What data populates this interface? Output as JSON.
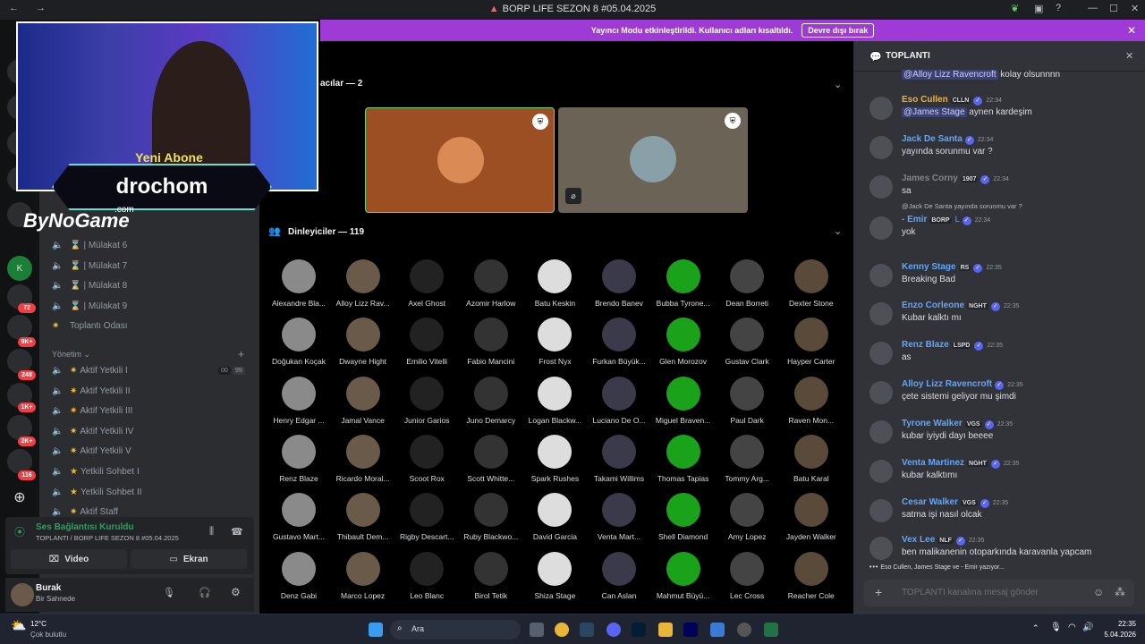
{
  "window": {
    "title": "BORP LIFE SEZON 8 #05.04.2025",
    "nav": "← →",
    "minimize": "—",
    "maximize": "☐",
    "close": "✕"
  },
  "banner": {
    "text": "Yayıncı Modu etkinleştirildi. Kullanıcı adları kısaltıldı.",
    "button": "Devre dışı bırak"
  },
  "guild_badges": [
    "72",
    "9K+",
    "248",
    "1K+",
    "2K+",
    "116"
  ],
  "channels": {
    "items": [
      {
        "name": "| Mülakat 6"
      },
      {
        "name": "| Mülakat 7"
      },
      {
        "name": "| Mülakat 8"
      },
      {
        "name": "| Mülakat 9"
      }
    ],
    "meeting_room": "Toplantı Odası",
    "category": "Yönetim",
    "admin_items": [
      {
        "name": "Aktif Yetkili I",
        "c1": "00",
        "c2": "99"
      },
      {
        "name": "Aktif Yetkili II"
      },
      {
        "name": "Aktif Yetkili III"
      },
      {
        "name": "Aktif Yetkili IV"
      },
      {
        "name": "Aktif Yetkili V"
      },
      {
        "name": "Yetkili Sohbet I"
      },
      {
        "name": "Yetkili Sohbet II"
      },
      {
        "name": "Aktif Staff"
      }
    ]
  },
  "voice": {
    "status": "Ses Bağlantısı Kuruldu",
    "channel": "TOPLANTI / BORP LIFE SEZON 8 #05.04.2025",
    "video": "Video",
    "screen": "Ekran"
  },
  "user": {
    "name": "Burak",
    "status": "Bir Sahnede"
  },
  "stream": {
    "label": "Yeni Abone",
    "name": "drochom",
    "watermark": "ByNoGame",
    "watermark_sub": ".com"
  },
  "stage": {
    "speakers_title": "acılar — 2",
    "listeners_title": "Dinleyiciler — 119",
    "listeners": [
      "Alexandre Bla...",
      "Alloy Lizz Rav...",
      "Axel Ghost",
      "Azomir Harlow",
      "Batu Keskin",
      "Brendo Banev",
      "Bubba Tyrone...",
      "Dean Borreti",
      "Dexter Stone",
      "Doğukan Koçak",
      "Dwayne Hight",
      "Emilio Vitelli",
      "Fabio Mancini",
      "Frost Nyx",
      "Furkan Büyük...",
      "Glen Morozov",
      "Gustav Clark",
      "Hayper Carter",
      "Henry Edgar ...",
      "Jamal Vance",
      "Junior Garios",
      "Juno Demarcy",
      "Logan Blackw...",
      "Luciano De O...",
      "Miguel Braven...",
      "Paul Dark",
      "Raven Mon...",
      "Renz Blaze",
      "Ricardo Moral...",
      "Scoot Rox",
      "Scott Whitte...",
      "Spark Rushes",
      "Takami Willims",
      "Thomas Tapias",
      "Tommy Arg...",
      "Batu Karal",
      "Gustavo Mart...",
      "Thibault Dem...",
      "Rigby Descart...",
      "Ruby Blackwo...",
      "David Garcia",
      "Venta Mart...",
      "Shell Diamond",
      "Amy Lopez",
      "Jayden Walker",
      "Denz Gabi",
      "Marco Lopez",
      "Leo Blanc",
      "Birol Tetik",
      "Shiza Stage",
      "Can Aslan",
      "Mahmut Büyü...",
      "Lec Cross",
      "Reacher Cole"
    ]
  },
  "chat": {
    "title": "TOPLANTI",
    "placeholder": "TOPLANTI kanalına mesaj gönder",
    "typing": "Eso Cullen, James Stage ve - Emir yazıyor...",
    "first_line": "@Alloy Lizz Ravencroft",
    "first_rest": " kolay olsunnnn",
    "messages": [
      {
        "user": "Eso Cullen",
        "color": "#f0b232",
        "tag": "CLLN",
        "time": "22:34",
        "mention": "@James Stage",
        "text": " aynen kardeşim"
      },
      {
        "user": "Jack De Santa",
        "color": "#5ea7ff",
        "tag": "",
        "time": "22:34",
        "mention": "",
        "text": "yayında sorunmu var ?"
      },
      {
        "user": "James Corny",
        "color": "#80848e",
        "tag": "1907",
        "time": "22:34",
        "mention": "",
        "text": "sa"
      },
      {
        "user": "- Emir",
        "color": "#5ea7ff",
        "tag": "BORP",
        "time": "22:34",
        "mention": "",
        "text": "yok",
        "reply": "@Jack De Santa yayında sorunmu var ?",
        "mark": "L"
      },
      {
        "user": "Kenny Stage",
        "color": "#5ea7ff",
        "tag": "RS",
        "time": "22:35",
        "mention": "",
        "text": "Breaking Bad"
      },
      {
        "user": "Enzo Corleone",
        "color": "#5ea7ff",
        "tag": "NGHT",
        "time": "22:35",
        "mention": "",
        "text": "Kubar kalktı mı"
      },
      {
        "user": "Renz Blaze",
        "color": "#5ea7ff",
        "tag": "LSPD",
        "time": "22:35",
        "mention": "",
        "text": "as"
      },
      {
        "user": "Alloy Lizz Ravencroft",
        "color": "#5ea7ff",
        "tag": "",
        "time": "22:35",
        "mention": "",
        "text": "çete sistemi geliyor mu şimdi"
      },
      {
        "user": "Tyrone Walker",
        "color": "#5ea7ff",
        "tag": "VGS",
        "time": "22:35",
        "mention": "",
        "text": "kubar iyiydi dayı beeee"
      },
      {
        "user": "Venta Martinez",
        "color": "#5ea7ff",
        "tag": "NGHT",
        "time": "22:35",
        "mention": "",
        "text": "kubar kalktımı"
      },
      {
        "user": "Cesar Walker",
        "color": "#5ea7ff",
        "tag": "VGS",
        "time": "22:35",
        "mention": "",
        "text": "satma işi nasıl olcak"
      },
      {
        "user": "Vex Lee",
        "color": "#5ea7ff",
        "tag": "NLF",
        "time": "22:35",
        "mention": "",
        "text": "ben malikanenin otoparkında karavanla yapcam"
      }
    ]
  },
  "taskbar": {
    "temp": "12°C",
    "weather": "Çok bulutlu",
    "search": "Ara",
    "time": "22:35",
    "date": "5.04.2026"
  }
}
